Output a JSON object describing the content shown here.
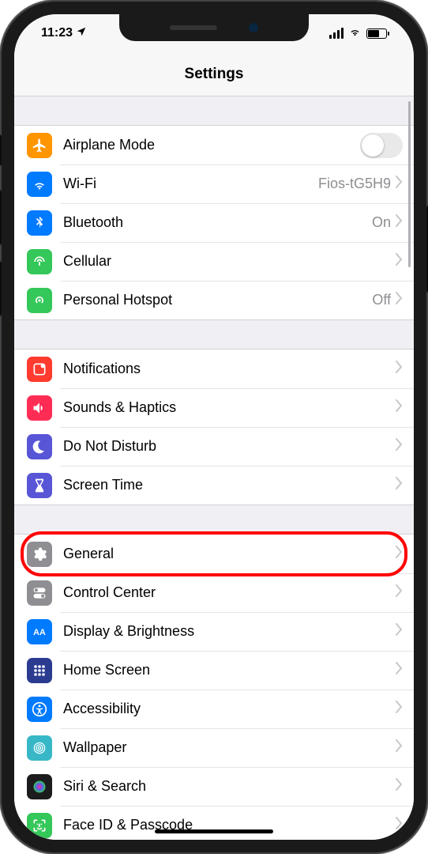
{
  "status": {
    "time": "11:23"
  },
  "title": "Settings",
  "groups": [
    {
      "rows": [
        {
          "key": "airplane",
          "icon": "airplane-icon",
          "color": "#ff9500",
          "label": "Airplane Mode",
          "control": "toggle",
          "value": ""
        },
        {
          "key": "wifi",
          "icon": "wifi-icon",
          "color": "#007aff",
          "label": "Wi-Fi",
          "control": "detail",
          "value": "Fios-tG5H9"
        },
        {
          "key": "bluetooth",
          "icon": "bluetooth-icon",
          "color": "#007aff",
          "label": "Bluetooth",
          "control": "detail",
          "value": "On"
        },
        {
          "key": "cellular",
          "icon": "cellular-icon",
          "color": "#34c759",
          "label": "Cellular",
          "control": "detail",
          "value": ""
        },
        {
          "key": "hotspot",
          "icon": "hotspot-icon",
          "color": "#34c759",
          "label": "Personal Hotspot",
          "control": "detail",
          "value": "Off"
        }
      ]
    },
    {
      "rows": [
        {
          "key": "notifications",
          "icon": "notifications-icon",
          "color": "#ff3b30",
          "label": "Notifications",
          "control": "detail",
          "value": ""
        },
        {
          "key": "sounds",
          "icon": "sounds-icon",
          "color": "#ff2d55",
          "label": "Sounds & Haptics",
          "control": "detail",
          "value": ""
        },
        {
          "key": "dnd",
          "icon": "dnd-icon",
          "color": "#5856d6",
          "label": "Do Not Disturb",
          "control": "detail",
          "value": ""
        },
        {
          "key": "screentime",
          "icon": "screentime-icon",
          "color": "#5856d6",
          "label": "Screen Time",
          "control": "detail",
          "value": ""
        }
      ]
    },
    {
      "rows": [
        {
          "key": "general",
          "icon": "general-icon",
          "color": "#8e8e93",
          "label": "General",
          "control": "detail",
          "value": "",
          "highlighted": true
        },
        {
          "key": "controlcenter",
          "icon": "controlcenter-icon",
          "color": "#8e8e93",
          "label": "Control Center",
          "control": "detail",
          "value": ""
        },
        {
          "key": "display",
          "icon": "display-icon",
          "color": "#007aff",
          "label": "Display & Brightness",
          "control": "detail",
          "value": ""
        },
        {
          "key": "homescreen",
          "icon": "homescreen-icon",
          "color": "#2b3b8f",
          "label": "Home Screen",
          "control": "detail",
          "value": ""
        },
        {
          "key": "accessibility",
          "icon": "accessibility-icon",
          "color": "#007aff",
          "label": "Accessibility",
          "control": "detail",
          "value": ""
        },
        {
          "key": "wallpaper",
          "icon": "wallpaper-icon",
          "color": "#38b8c7",
          "label": "Wallpaper",
          "control": "detail",
          "value": ""
        },
        {
          "key": "siri",
          "icon": "siri-icon",
          "color": "#1c1c1e",
          "label": "Siri & Search",
          "control": "detail",
          "value": ""
        },
        {
          "key": "faceid",
          "icon": "faceid-icon",
          "color": "#34c759",
          "label": "Face ID & Passcode",
          "control": "detail",
          "value": ""
        }
      ]
    }
  ]
}
